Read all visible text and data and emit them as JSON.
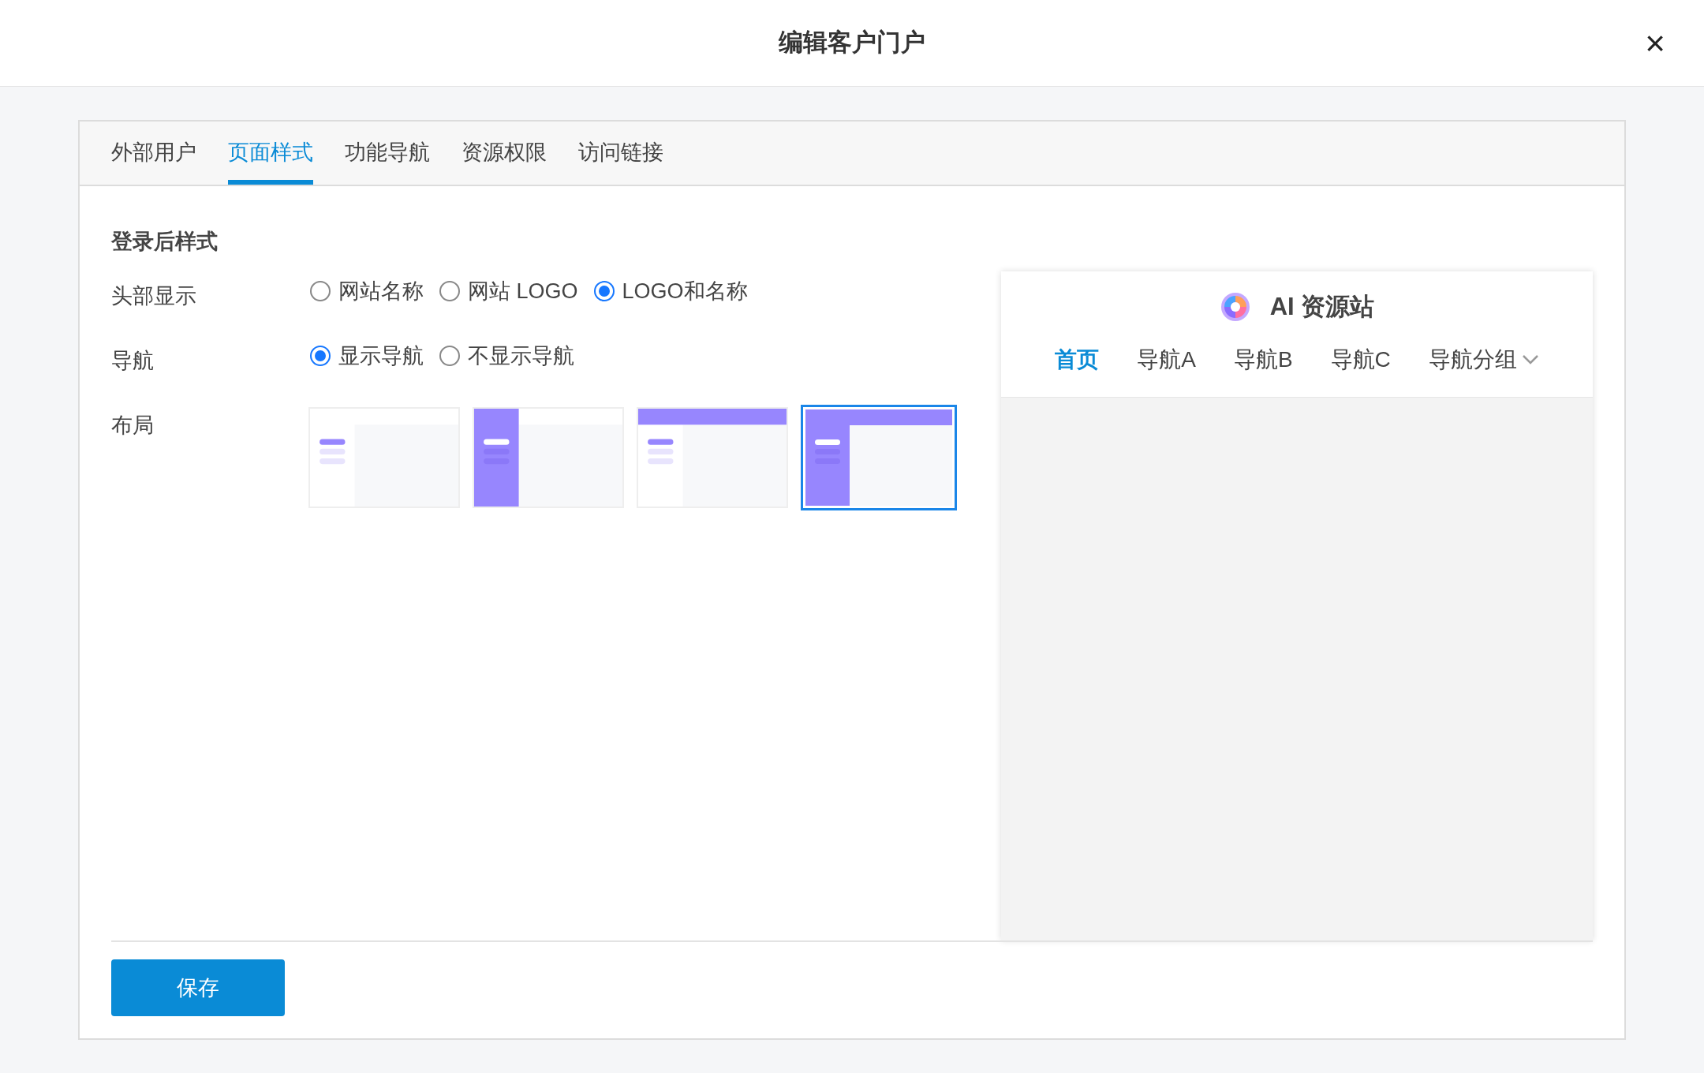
{
  "dialog": {
    "title": "编辑客户门户",
    "close": "×"
  },
  "tabs": [
    {
      "label": "外部用户",
      "selected": false
    },
    {
      "label": "页面样式",
      "selected": true
    },
    {
      "label": "功能导航",
      "selected": false
    },
    {
      "label": "资源权限",
      "selected": false
    },
    {
      "label": "访问链接",
      "selected": false
    }
  ],
  "section_title": "登录后样式",
  "header_display": {
    "label": "头部显示",
    "options": [
      {
        "label": "网站名称",
        "selected": false
      },
      {
        "label": "网站 LOGO",
        "selected": false
      },
      {
        "label": "LOGO和名称",
        "selected": true
      }
    ]
  },
  "navigation": {
    "label": "导航",
    "options": [
      {
        "label": "显示导航",
        "selected": true
      },
      {
        "label": "不显示导航",
        "selected": false
      }
    ]
  },
  "layout": {
    "label": "布局",
    "options": [
      {
        "kind": "side-light",
        "selected": false
      },
      {
        "kind": "side-dark",
        "selected": false
      },
      {
        "kind": "top-light",
        "selected": false
      },
      {
        "kind": "top-dark",
        "selected": true
      }
    ]
  },
  "preview": {
    "site_name": "AI 资源站",
    "nav": [
      {
        "label": "首页",
        "selected": true,
        "dropdown": false
      },
      {
        "label": "导航A",
        "selected": false,
        "dropdown": false
      },
      {
        "label": "导航B",
        "selected": false,
        "dropdown": false
      },
      {
        "label": "导航C",
        "selected": false,
        "dropdown": false
      },
      {
        "label": "导航分组",
        "selected": false,
        "dropdown": true
      }
    ]
  },
  "save_button": "保存"
}
